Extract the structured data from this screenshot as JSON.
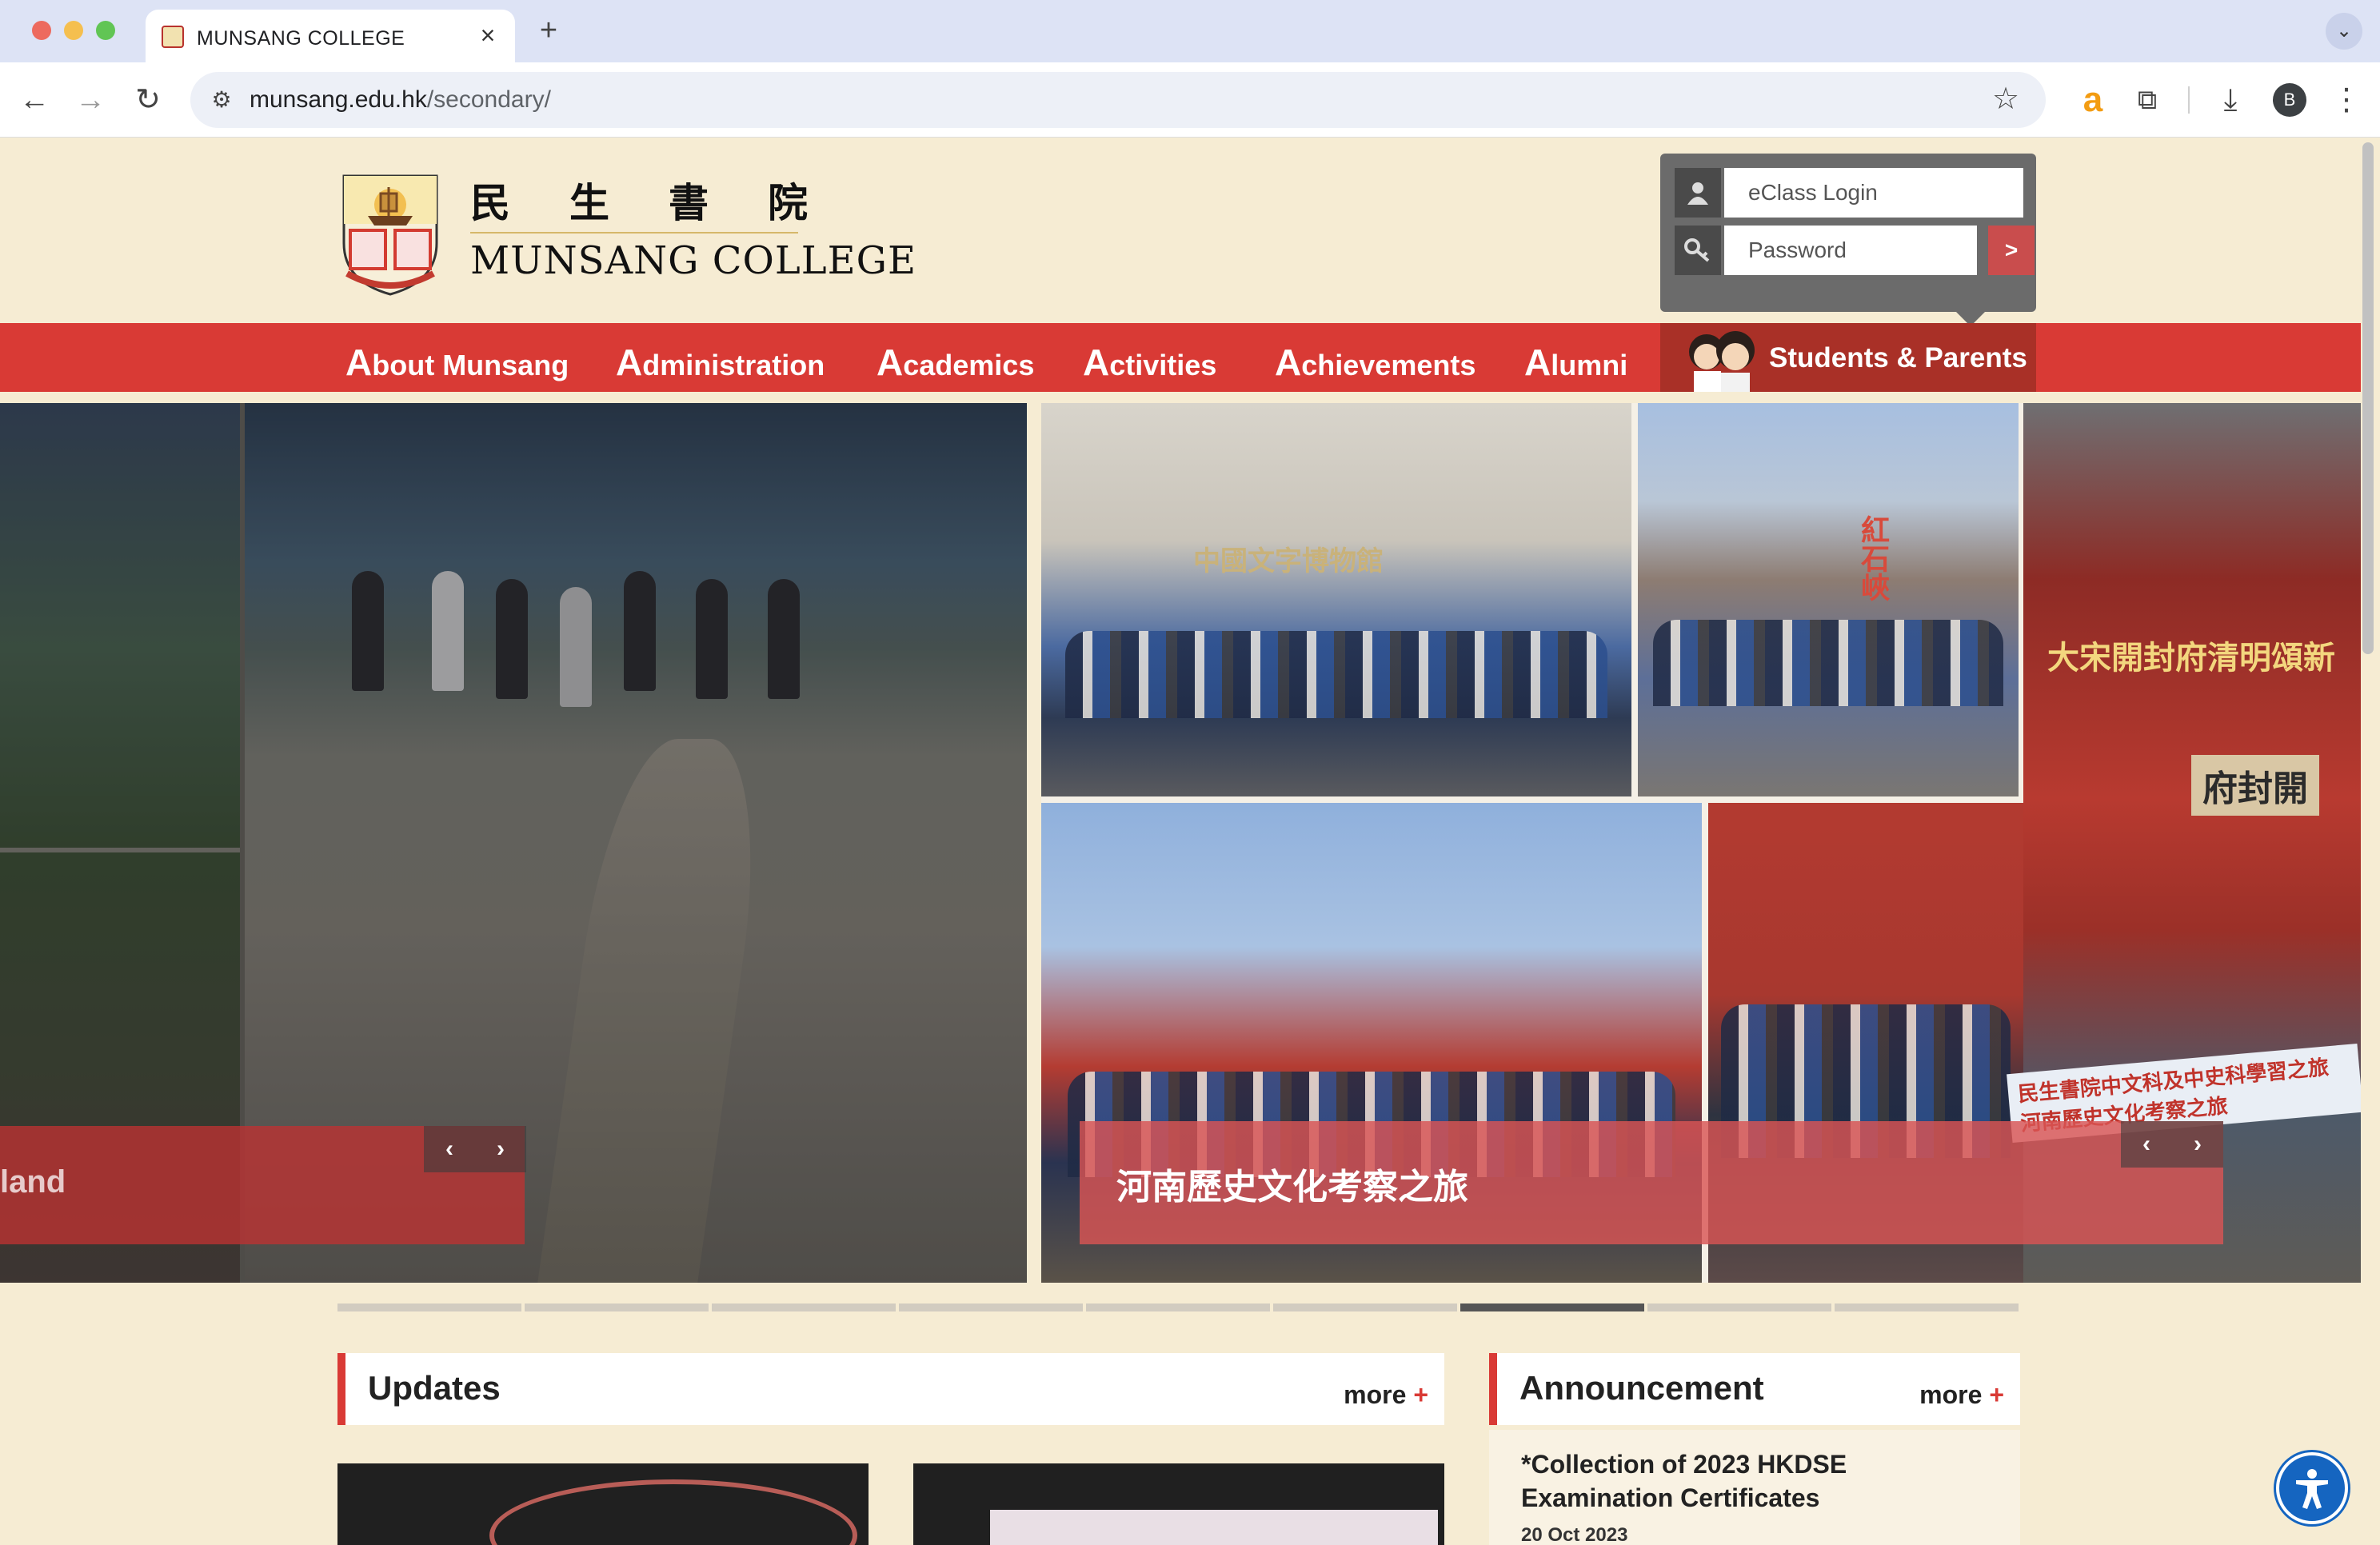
{
  "browser": {
    "tab_title": "MUNSANG COLLEGE",
    "tab_close": "×",
    "new_tab": "+",
    "url_host": "munsang.edu.hk",
    "url_path": "/secondary/",
    "avatar_letter": "B",
    "icons": [
      "back-icon",
      "forward-icon",
      "reload-icon",
      "site-info-icon",
      "star-icon",
      "extension-a-icon",
      "puzzle-icon",
      "download-icon",
      "menu-icon"
    ]
  },
  "header": {
    "logo_cn": "民生書院",
    "logo_en": "MUNSANG COLLEGE",
    "login": {
      "username_placeholder": "eClass Login",
      "password_placeholder": "Password",
      "submit_label": ">"
    }
  },
  "nav": {
    "items": [
      {
        "cap": "A",
        "rest": "bout Munsang"
      },
      {
        "cap": "A",
        "rest": "dministration"
      },
      {
        "cap": "A",
        "rest": "cademics"
      },
      {
        "cap": "A",
        "rest": "ctivities"
      },
      {
        "cap": "A",
        "rest": "chievements"
      },
      {
        "cap": "A",
        "rest": "lumni"
      }
    ],
    "students_parents": "Students & Parents"
  },
  "slider": {
    "left_caption": "land",
    "right_caption": "河南歷史文化考察之旅",
    "prev_label": "‹",
    "next_label": "›",
    "signs": {
      "museum": "中國文字博物館",
      "rock": "紅石峽",
      "gate_banner": "大宋開封府清明頌新",
      "plaque": "府封開",
      "group_banner": "民生書院中文科及中史科學習之旅 河南歷史文化考察之旅"
    },
    "slide_count": 9,
    "active_slide_index": 6
  },
  "updates": {
    "title": "Updates",
    "more_label": "more",
    "more_plus": "+"
  },
  "announcement": {
    "title": "Announcement",
    "more_label": "more",
    "more_plus": "+",
    "items": [
      {
        "title": "*Collection of 2023 HKDSE Examination Certificates",
        "date": "20 Oct 2023"
      }
    ]
  },
  "accessibility_button_icon": "accessibility-icon",
  "colors": {
    "brand_red": "#d93a35",
    "brand_dark_red": "#a93027",
    "page_bg": "#f6ecd3"
  }
}
